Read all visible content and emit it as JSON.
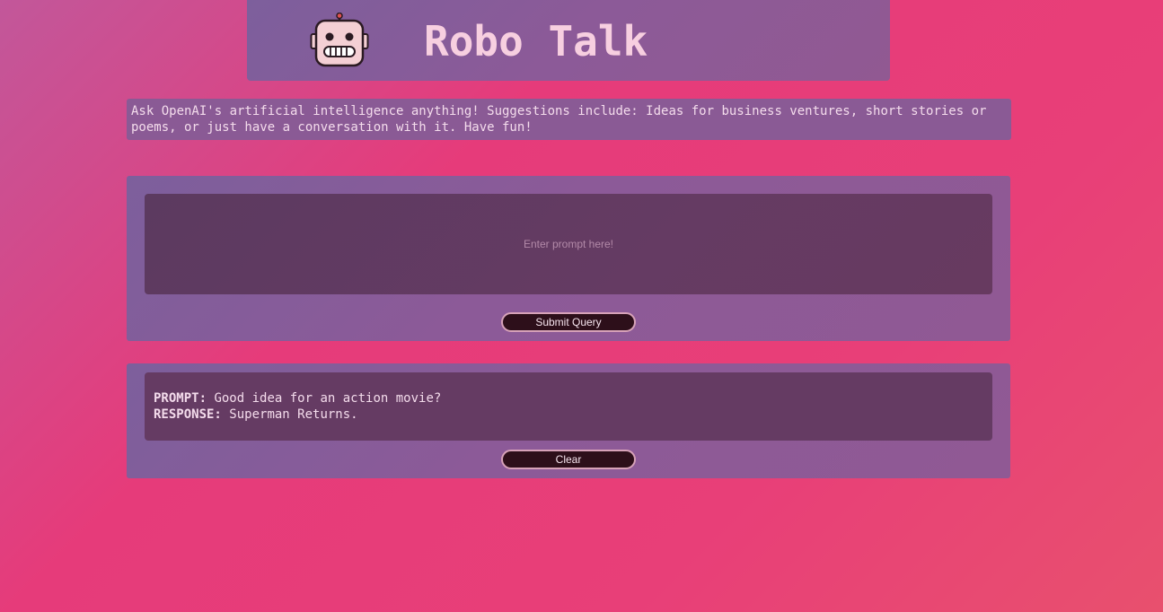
{
  "app": {
    "title": "Robo Talk",
    "logo_icon": "robot-icon"
  },
  "intro": {
    "text": "Ask OpenAI's artificial intelligence anything! Suggestions include: Ideas for business ventures, short stories or poems, or just have a conversation with it. Have fun!"
  },
  "form": {
    "prompt_value": "",
    "prompt_placeholder": "Enter prompt here!",
    "submit_label": "Submit Query"
  },
  "results": [
    {
      "prompt_label": "PROMPT:",
      "prompt_text": "Good idea for an action movie?",
      "response_label": "RESPONSE:",
      "response_text": "Superman Returns."
    }
  ],
  "clear_label": "Clear",
  "colors": {
    "accent_text": "#f7cfe0",
    "panel": "#8a5a95",
    "input_bg": "#653b63",
    "button_bg": "#2d0f1a"
  }
}
